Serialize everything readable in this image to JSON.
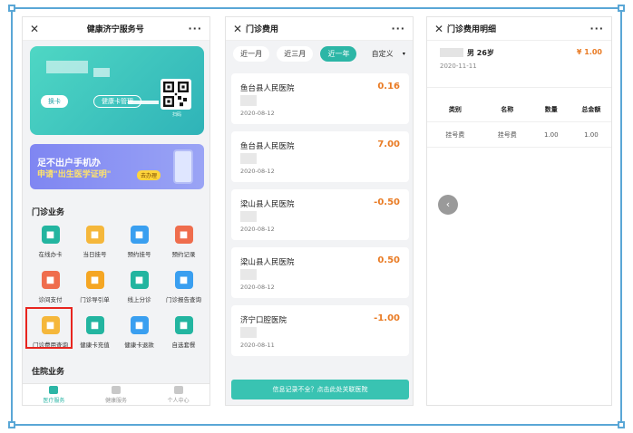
{
  "panel1": {
    "title": "健康济宁服务号",
    "card": {
      "swap_label": "换卡",
      "manage_label": "健康卡管理",
      "qr_label": "扫码"
    },
    "promo": {
      "line1": "足不出户手机办",
      "line2": "申请\"出生医学证明\"",
      "go_label": "去办理"
    },
    "outpatient_section": "门诊业务",
    "outpatient_items": [
      {
        "label": "在线办卡",
        "icon": "card-add-icon",
        "color": "#23b5a0"
      },
      {
        "label": "当日挂号",
        "icon": "calendar-icon",
        "color": "#f5b73b"
      },
      {
        "label": "预约挂号",
        "icon": "calendar-check-icon",
        "color": "#3a9ff0"
      },
      {
        "label": "预约记录",
        "icon": "record-icon",
        "color": "#ef6d4d"
      },
      {
        "label": "诊间支付",
        "icon": "pay-icon",
        "color": "#ef6d4d"
      },
      {
        "label": "门诊导引单",
        "icon": "guide-icon",
        "color": "#f5a623"
      },
      {
        "label": "线上分诊",
        "icon": "doctor-icon",
        "color": "#23b5a0"
      },
      {
        "label": "门诊报告查询",
        "icon": "stethoscope-icon",
        "color": "#3a9ff0"
      },
      {
        "label": "门诊费用查询",
        "icon": "fee-icon",
        "color": "#f5b73b"
      },
      {
        "label": "健康卡充值",
        "icon": "recharge-icon",
        "color": "#23b5a0"
      },
      {
        "label": "健康卡退款",
        "icon": "refund-icon",
        "color": "#3a9ff0"
      },
      {
        "label": "自选套餐",
        "icon": "bag-icon",
        "color": "#23b5a0"
      }
    ],
    "inpatient_section": "住院业务",
    "nav": [
      {
        "label": "医疗服务",
        "active": true
      },
      {
        "label": "健康服务",
        "active": false
      },
      {
        "label": "个人中心",
        "active": false
      }
    ]
  },
  "panel2": {
    "title": "门诊费用",
    "filters": [
      "近一月",
      "近三月",
      "近一年",
      "自定义"
    ],
    "active_filter": 2,
    "records": [
      {
        "hospital": "鱼台县人民医院",
        "amount": "0.16",
        "date": "2020-08-12"
      },
      {
        "hospital": "鱼台县人民医院",
        "amount": "7.00",
        "date": "2020-08-12"
      },
      {
        "hospital": "梁山县人民医院",
        "amount": "-0.50",
        "date": "2020-08-12"
      },
      {
        "hospital": "梁山县人民医院",
        "amount": "0.50",
        "date": "2020-08-12"
      },
      {
        "hospital": "济宁口腔医院",
        "amount": "-1.00",
        "date": "2020-08-11"
      }
    ],
    "notice": "信息记录不全？点击此处关联医院"
  },
  "panel3": {
    "title": "门诊费用明细",
    "patient": "男 26岁",
    "price": "¥ 1.00",
    "date": "2020-11-11",
    "columns": [
      "类别",
      "名称",
      "数量",
      "总金额"
    ],
    "rows": [
      [
        "挂号费",
        "挂号费",
        "1.00",
        "1.00"
      ]
    ]
  }
}
